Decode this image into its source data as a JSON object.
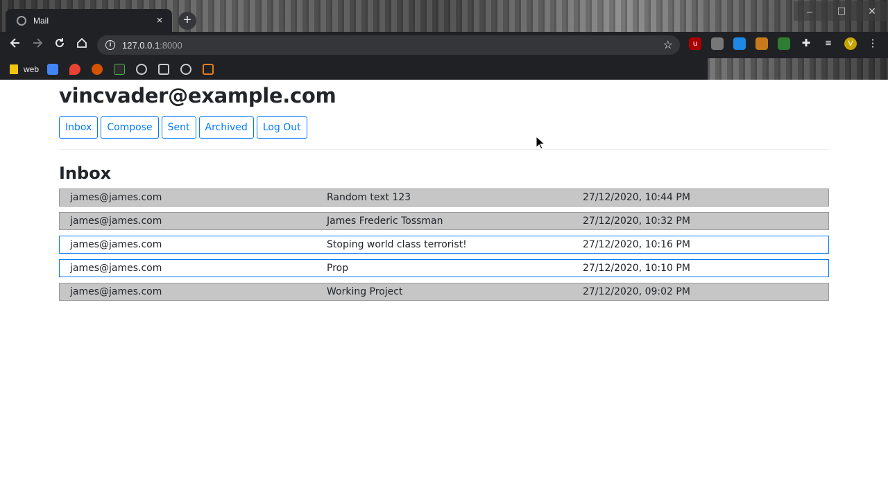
{
  "browser": {
    "tab_title": "Mail",
    "tab_close": "×",
    "new_tab": "+",
    "url_host": "127.0.0.1",
    "url_port": ":8000",
    "window_controls": [
      "–",
      "☐",
      "✕"
    ],
    "bookmarks": [
      {
        "label": "web",
        "icon": "folder-icon"
      }
    ]
  },
  "header": {
    "user_email": "vincvader@example.com"
  },
  "nav": {
    "inbox": "Inbox",
    "compose": "Compose",
    "sent": "Sent",
    "archived": "Archived",
    "logout": "Log Out"
  },
  "mailbox": {
    "title": "Inbox",
    "emails": [
      {
        "sender": "james@james.com",
        "subject": "Random text 123",
        "timestamp": "27/12/2020, 10:44 PM",
        "read": true
      },
      {
        "sender": "james@james.com",
        "subject": "James Frederic Tossman",
        "timestamp": "27/12/2020, 10:32 PM",
        "read": true
      },
      {
        "sender": "james@james.com",
        "subject": "Stoping world class terrorist!",
        "timestamp": "27/12/2020, 10:16 PM",
        "read": false
      },
      {
        "sender": "james@james.com",
        "subject": "Prop",
        "timestamp": "27/12/2020, 10:10 PM",
        "read": false
      },
      {
        "sender": "james@james.com",
        "subject": "Working Project",
        "timestamp": "27/12/2020, 09:02 PM",
        "read": true
      }
    ]
  },
  "colors": {
    "accent": "#007bff",
    "read_row": "#c6c6c6",
    "text": "#212529"
  }
}
